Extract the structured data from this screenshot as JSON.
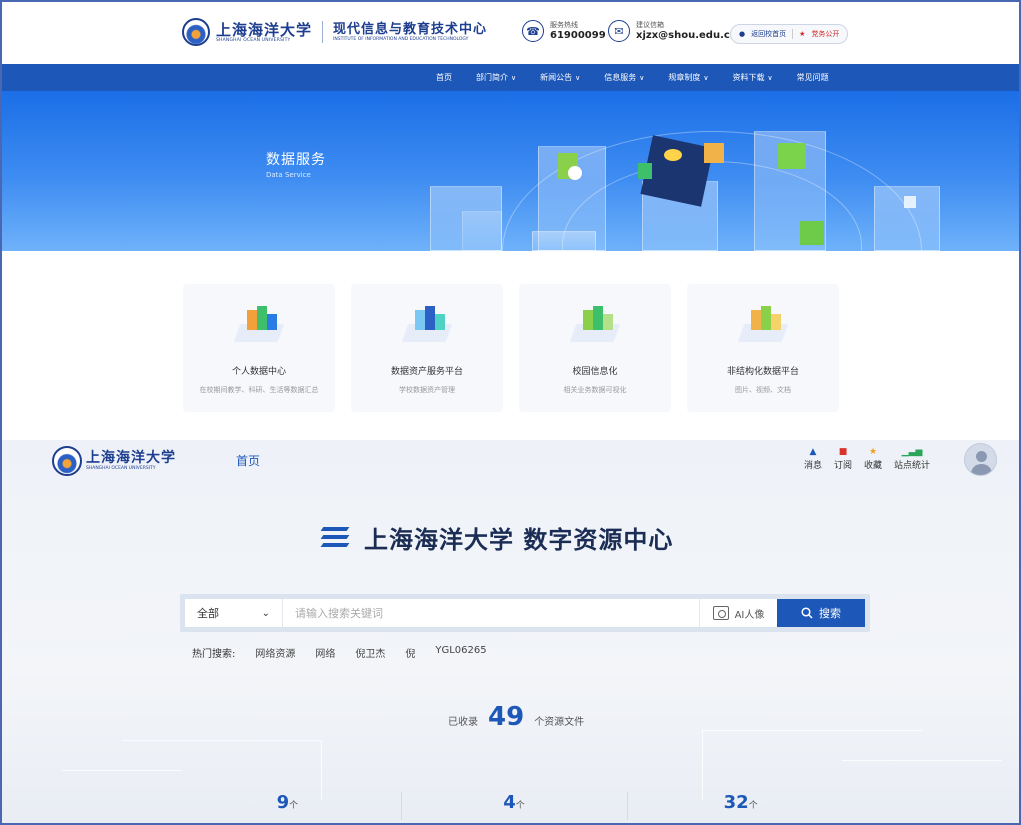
{
  "site": {
    "logo_cn": "上海海洋大学",
    "logo_en": "SHANGHAI OCEAN UNIVERSITY",
    "center_cn": "现代信息与教育技术中心",
    "center_en": "INSTITUTE OF INFORMATION AND EDUCATION TECHNOLOGY"
  },
  "contacts": [
    {
      "icon": "phone-icon",
      "label": "服务热线",
      "value": "61900099"
    },
    {
      "icon": "mail-icon",
      "label": "建议信箱",
      "value": "xjzx@shou.edu.cn"
    }
  ],
  "links": {
    "home": "返回校首页",
    "party": "党务公开"
  },
  "nav": [
    {
      "label": "首页",
      "dropdown": false
    },
    {
      "label": "部门简介",
      "dropdown": true
    },
    {
      "label": "新闻公告",
      "dropdown": true
    },
    {
      "label": "信息服务",
      "dropdown": true
    },
    {
      "label": "规章制度",
      "dropdown": true
    },
    {
      "label": "资料下载",
      "dropdown": true
    },
    {
      "label": "常见问题",
      "dropdown": false
    }
  ],
  "banner": {
    "title": "数据服务",
    "subtitle": "Data Service"
  },
  "cards": [
    {
      "title": "个人数据中心",
      "desc": "在校期间教学、科研、生活等数据汇总",
      "icon": "personal-data-icon"
    },
    {
      "title": "数据资产服务平台",
      "desc": "学校数据资产管理",
      "icon": "data-asset-icon"
    },
    {
      "title": "校园信息化",
      "desc": "相关业务数据可视化",
      "icon": "campus-it-icon"
    },
    {
      "title": "非结构化数据平台",
      "desc": "图片、视频、文档",
      "icon": "unstructured-data-icon"
    }
  ],
  "portal": {
    "logo_cn": "上海海洋大学",
    "logo_en": "SHANGHAI OCEAN UNIVERSITY",
    "home": "首页",
    "tools": [
      {
        "label": "消息",
        "icon": "bell-icon",
        "color": "#1d57b8"
      },
      {
        "label": "订阅",
        "icon": "bookmark-icon",
        "color": "#d8322a"
      },
      {
        "label": "收藏",
        "icon": "star-icon",
        "color": "#f0a020"
      },
      {
        "label": "站点统计",
        "icon": "bar-chart-icon",
        "color": "#2aa55a"
      }
    ],
    "title": "上海海洋大学 数字资源中心",
    "search": {
      "scope": "全部",
      "placeholder": "请输入搜索关键词",
      "ai_label": "AI人像",
      "button": "搜索"
    },
    "hot_label": "热门搜索:",
    "hot_terms": [
      "网络资源",
      "网络",
      "倪卫杰",
      "倪",
      "YGL06265"
    ],
    "stats": {
      "pre": "已收录",
      "count": "49",
      "post": "个资源文件"
    },
    "counts": [
      {
        "num": "9",
        "unit": "个"
      },
      {
        "num": "4",
        "unit": "个"
      },
      {
        "num": "32",
        "unit": "个"
      }
    ]
  },
  "colors": {
    "primary": "#1d57b8",
    "navy": "#1d3d8f",
    "banner": "#3f8df2"
  }
}
